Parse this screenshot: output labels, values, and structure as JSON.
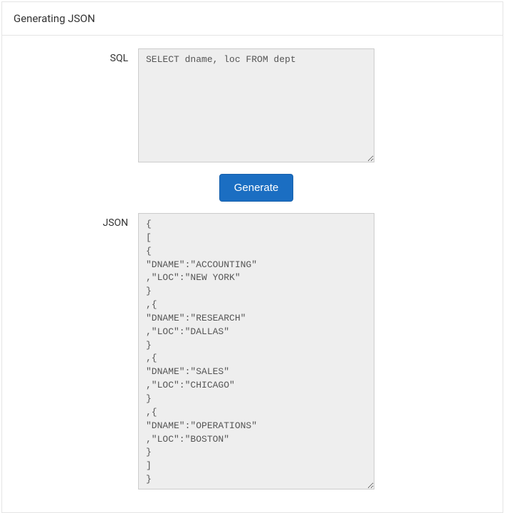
{
  "header": {
    "title": "Generating JSON"
  },
  "form": {
    "sql_label": "SQL",
    "sql_value": "SELECT dname, loc FROM dept",
    "generate_label": "Generate",
    "json_label": "JSON",
    "json_value": "{\n[\n{\n\"DNAME\":\"ACCOUNTING\"\n,\"LOC\":\"NEW YORK\"\n}\n,{\n\"DNAME\":\"RESEARCH\"\n,\"LOC\":\"DALLAS\"\n}\n,{\n\"DNAME\":\"SALES\"\n,\"LOC\":\"CHICAGO\"\n}\n,{\n\"DNAME\":\"OPERATIONS\"\n,\"LOC\":\"BOSTON\"\n}\n]\n}"
  }
}
